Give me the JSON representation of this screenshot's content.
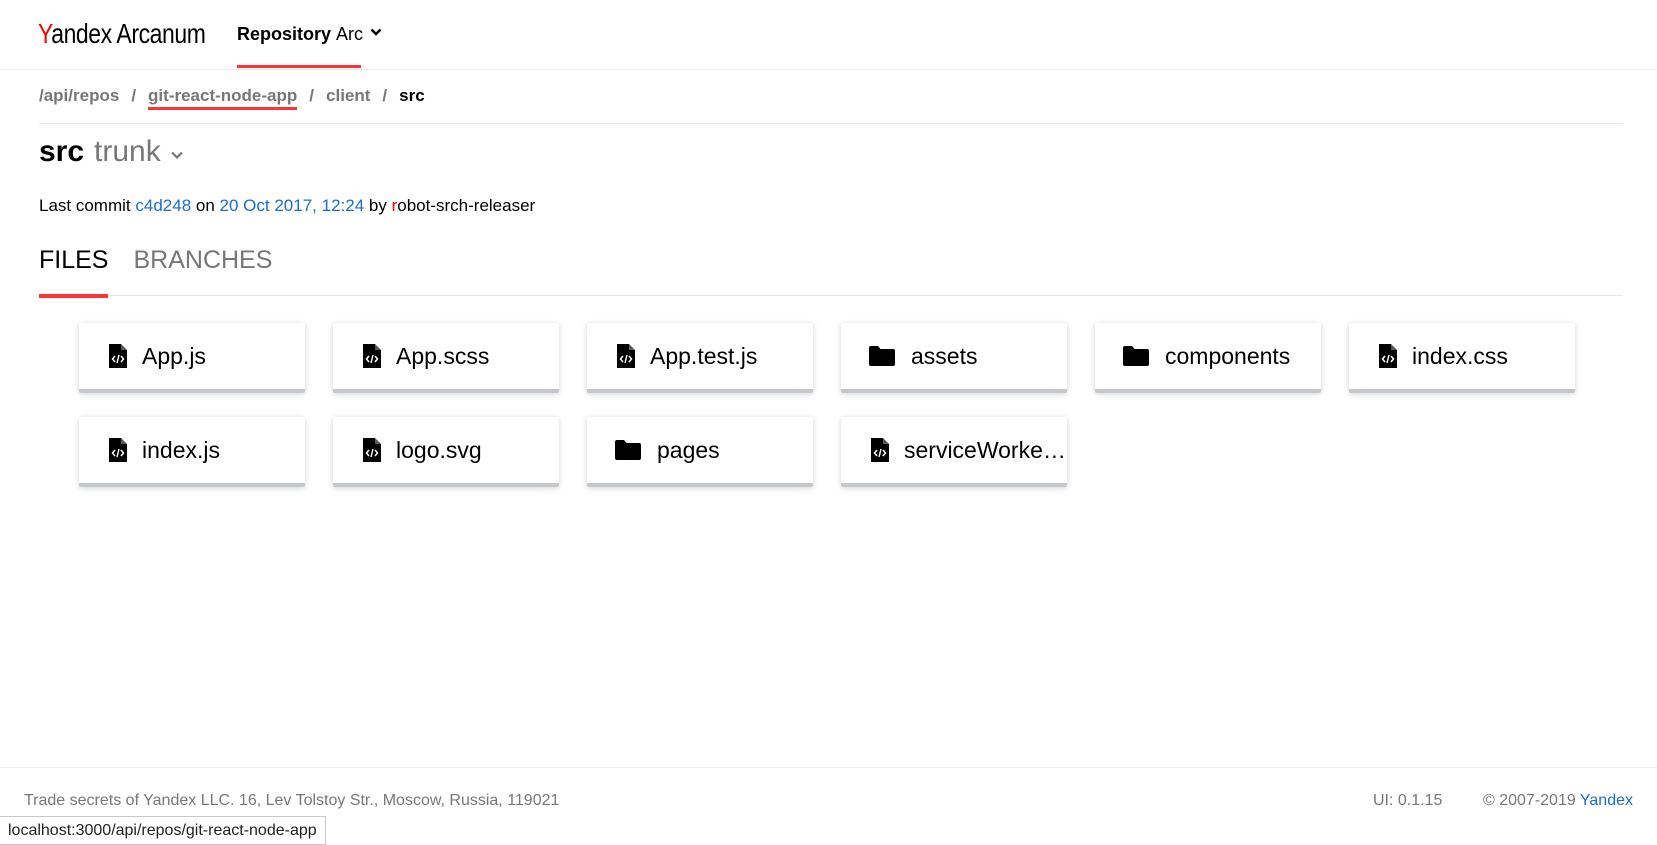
{
  "header": {
    "logo_brand": "Yandex",
    "logo_product": "Arcanum",
    "repo_menu_bold": "Repository",
    "repo_menu_name": "Arc"
  },
  "breadcrumb": [
    {
      "label": "/api/repos",
      "state": "link"
    },
    {
      "label": "git-react-node-app",
      "state": "active"
    },
    {
      "label": "client",
      "state": "link"
    },
    {
      "label": "src",
      "state": "current"
    }
  ],
  "breadcrumb_separator": "/",
  "title": {
    "dir": "src",
    "branch": "trunk"
  },
  "commit": {
    "prefix": "Last commit",
    "hash": "c4d248",
    "on_word": "on",
    "date": "20 Oct 2017, 12:24",
    "by_word": "by",
    "author_first": "r",
    "author_rest": "obot-srch-releaser"
  },
  "tabs": [
    {
      "label": "FILES",
      "active": true
    },
    {
      "label": "BRANCHES",
      "active": false
    }
  ],
  "entries": [
    {
      "name": "App.js",
      "type": "file"
    },
    {
      "name": "App.scss",
      "type": "file"
    },
    {
      "name": "App.test.js",
      "type": "file"
    },
    {
      "name": "assets",
      "type": "dir"
    },
    {
      "name": "components",
      "type": "dir"
    },
    {
      "name": "index.css",
      "type": "file"
    },
    {
      "name": "index.js",
      "type": "file"
    },
    {
      "name": "logo.svg",
      "type": "file"
    },
    {
      "name": "pages",
      "type": "dir"
    },
    {
      "name": "serviceWorker.js",
      "type": "file"
    }
  ],
  "footer": {
    "legal": "Trade secrets of Yandex LLC. 16, Lev Tolstoy Str., Moscow, Russia, 119021",
    "version": "UI: 0.1.15",
    "copyright": "© 2007-2019",
    "copyright_link": "Yandex"
  },
  "status_url": "localhost:3000/api/repos/git-react-node-app",
  "colors": {
    "accent": "#ff3333",
    "link": "#1a6bd6",
    "muted": "#777777"
  },
  "icons": {
    "file": "code-file-icon",
    "dir": "folder-icon"
  }
}
